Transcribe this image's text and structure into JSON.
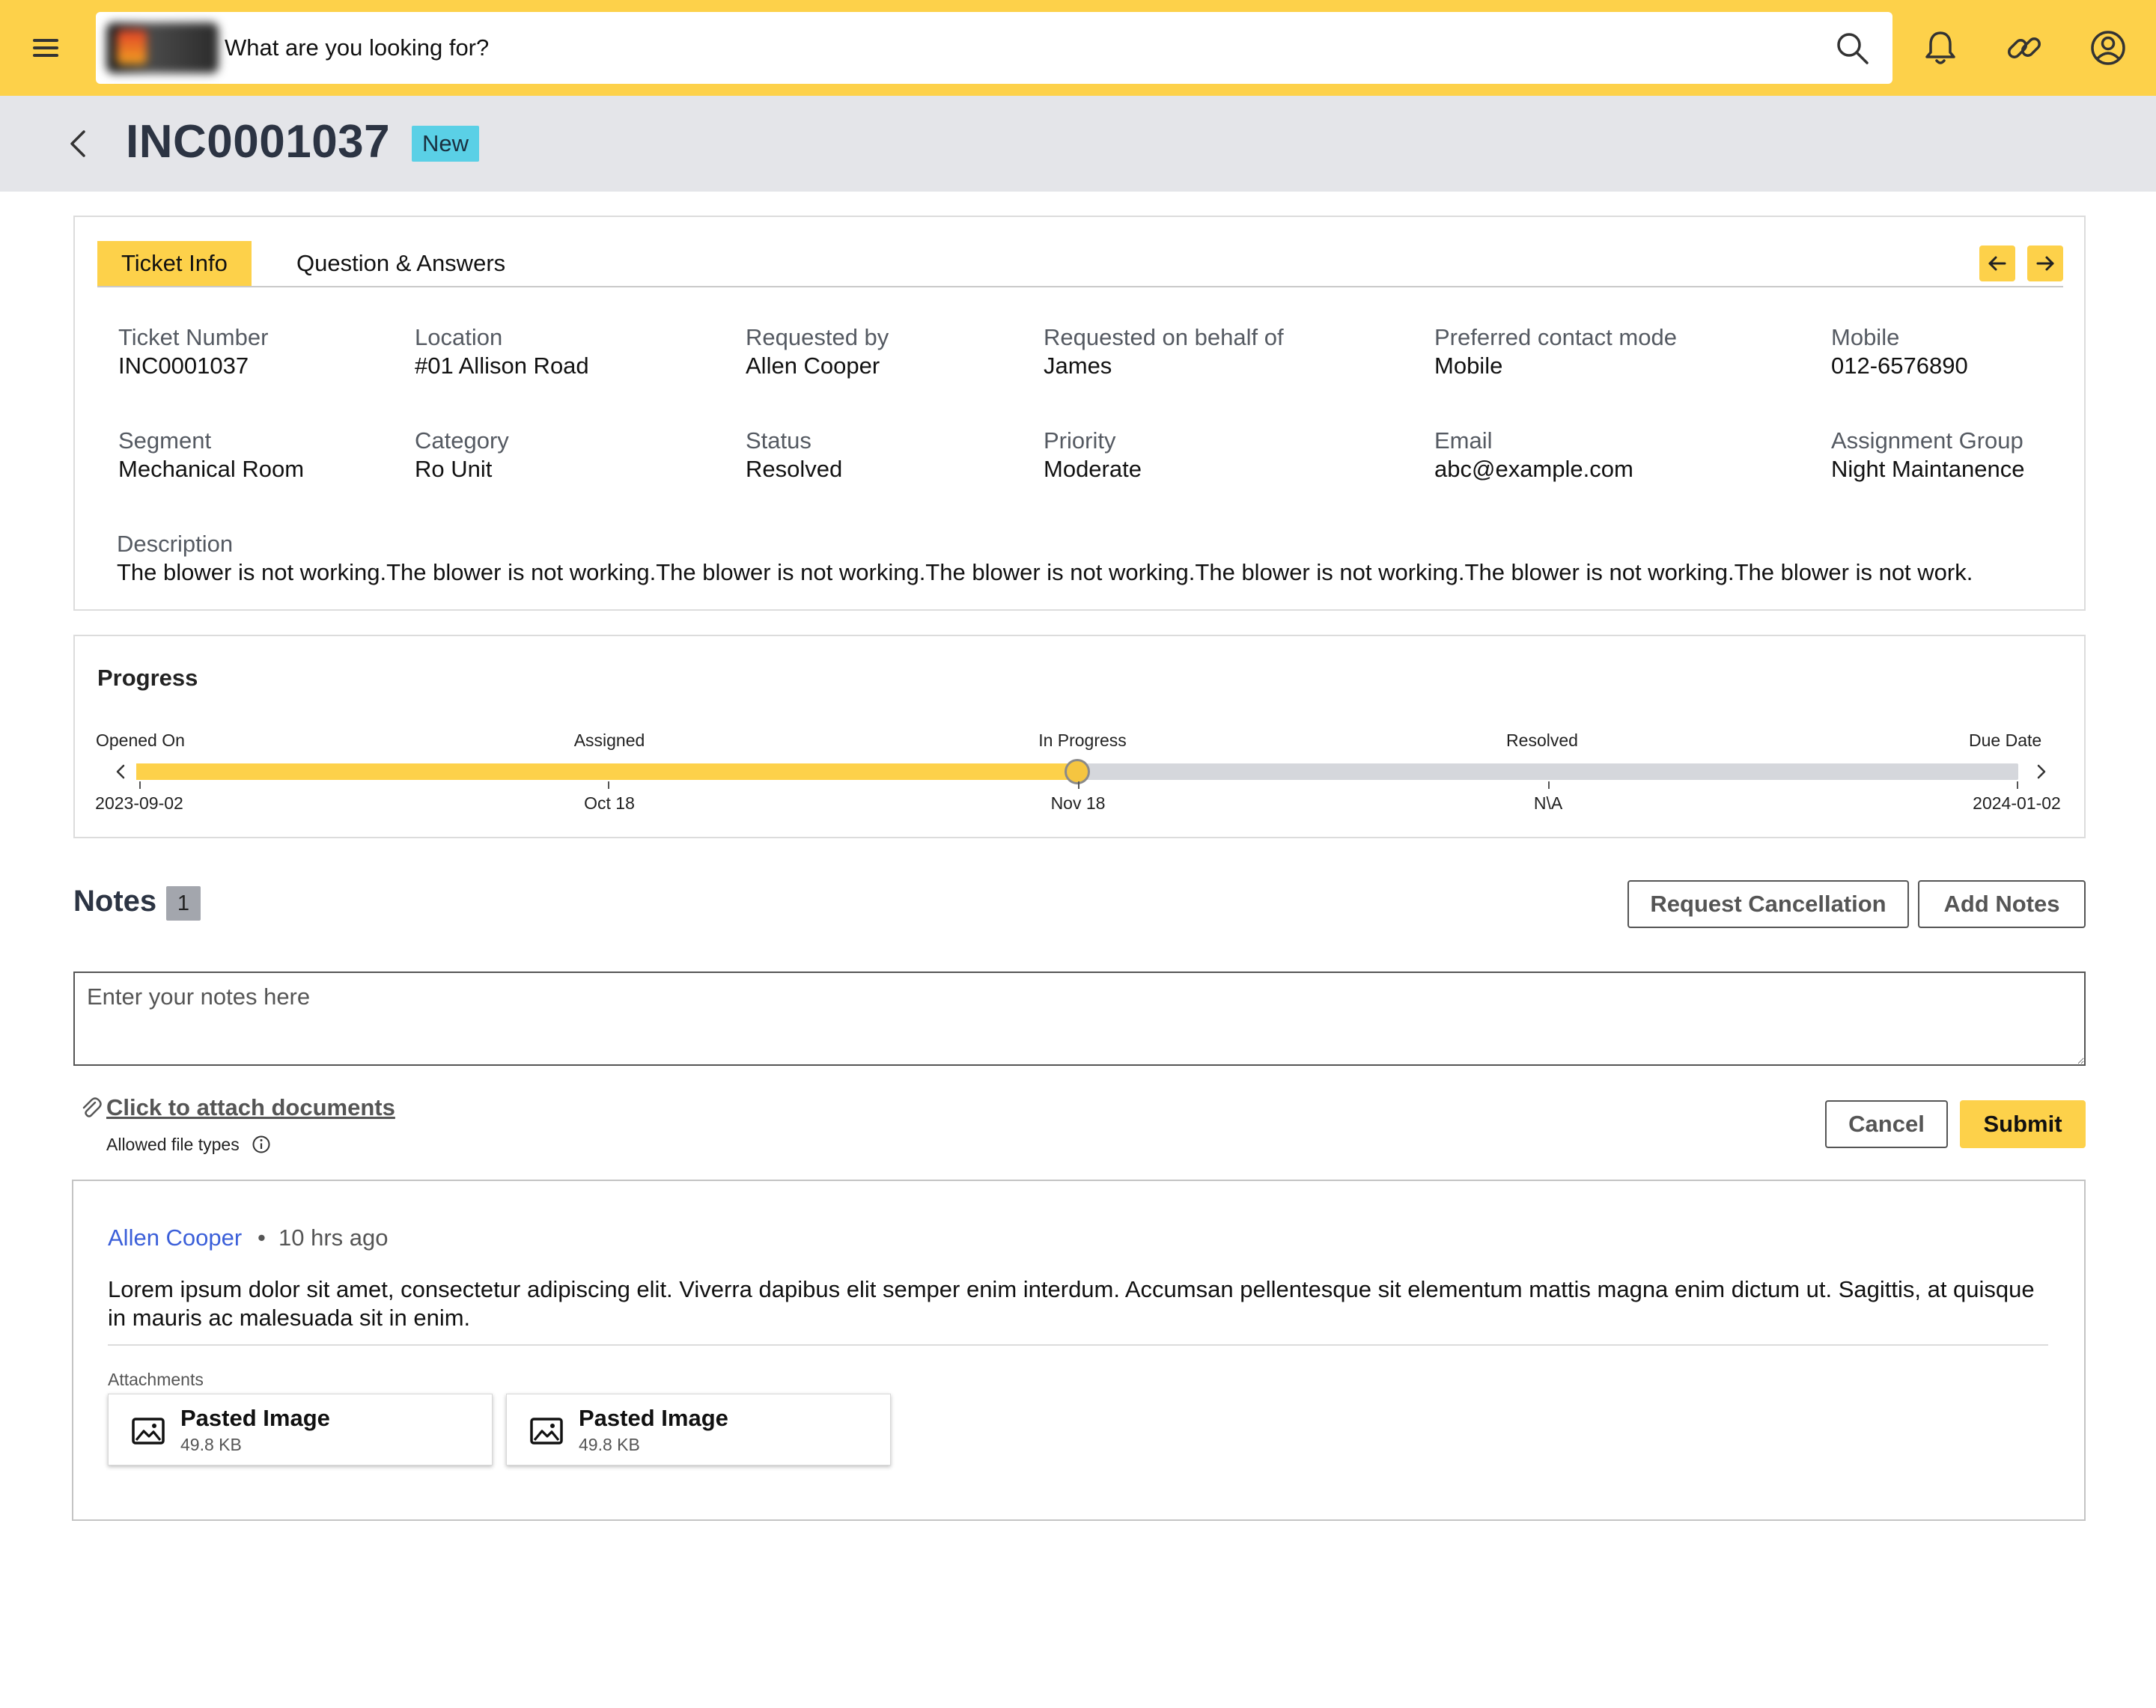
{
  "search": {
    "placeholder": "What are you looking for?"
  },
  "header": {
    "ticket_id": "INC0001037",
    "status": "New"
  },
  "tabs": [
    {
      "label": "Ticket Info"
    },
    {
      "label": "Question & Answers"
    }
  ],
  "ticket_info": {
    "fields": [
      {
        "label": "Ticket Number",
        "value": "INC0001037"
      },
      {
        "label": "Location",
        "value": "#01 Allison Road"
      },
      {
        "label": "Requested by",
        "value": "Allen Cooper"
      },
      {
        "label": "Requested on behalf of",
        "value": "James"
      },
      {
        "label": "Preferred contact mode",
        "value": "Mobile"
      },
      {
        "label": "Mobile",
        "value": "012-6576890"
      },
      {
        "label": "Segment",
        "value": "Mechanical Room"
      },
      {
        "label": "Category",
        "value": "Ro Unit"
      },
      {
        "label": "Status",
        "value": "Resolved"
      },
      {
        "label": "Priority",
        "value": "Moderate"
      },
      {
        "label": "Email",
        "value": "abc@example.com"
      },
      {
        "label": "Assignment Group",
        "value": "Night Maintanence"
      }
    ],
    "description_label": "Description",
    "description": "The blower is not working.The blower is not working.The blower is not working.The blower is not working.The blower is not working.The blower is not working.The blower is not work."
  },
  "progress": {
    "title": "Progress",
    "current_fraction": 0.5,
    "stages": [
      {
        "label": "Opened On",
        "date": "2023-09-02"
      },
      {
        "label": "Assigned",
        "date": "Oct 18"
      },
      {
        "label": "In Progress",
        "date": "Nov 18"
      },
      {
        "label": "Resolved",
        "date": "N\\A"
      },
      {
        "label": "Due Date",
        "date": "2024-01-02"
      }
    ]
  },
  "notes": {
    "title": "Notes",
    "count": "1",
    "request_cancellation_label": "Request Cancellation",
    "add_notes_label": "Add Notes",
    "placeholder": "Enter your notes here",
    "attach_link": "Click to attach documents",
    "allowed_types": "Allowed file types",
    "cancel_label": "Cancel",
    "submit_label": "Submit"
  },
  "note_entries": [
    {
      "author": "Allen Cooper",
      "separator": "•",
      "time": "10 hrs ago",
      "body": "Lorem ipsum dolor sit amet, consectetur adipiscing elit. Viverra dapibus elit semper enim interdum. Accumsan pellentesque sit elementum mattis magna enim dictum ut. Sagittis, at quisque in mauris ac malesuada sit in enim.",
      "attachments_label": "Attachments",
      "attachments": [
        {
          "name": "Pasted Image",
          "size": "49.8 KB"
        },
        {
          "name": "Pasted Image",
          "size": "49.8 KB"
        }
      ]
    }
  ],
  "icons": {
    "menu": "menu-icon",
    "search": "search-icon",
    "bell": "bell-icon",
    "link": "link-icon",
    "account": "account-icon",
    "back": "chevron-left-icon",
    "prev": "arrow-left-icon",
    "next": "arrow-right-icon",
    "paperclip": "paperclip-icon",
    "info": "info-icon",
    "image": "image-icon"
  },
  "colors": {
    "accent": "#fdd14a",
    "badge": "#5ad0e6",
    "link": "#3b5fd9",
    "header_band": "#e4e5e9"
  }
}
